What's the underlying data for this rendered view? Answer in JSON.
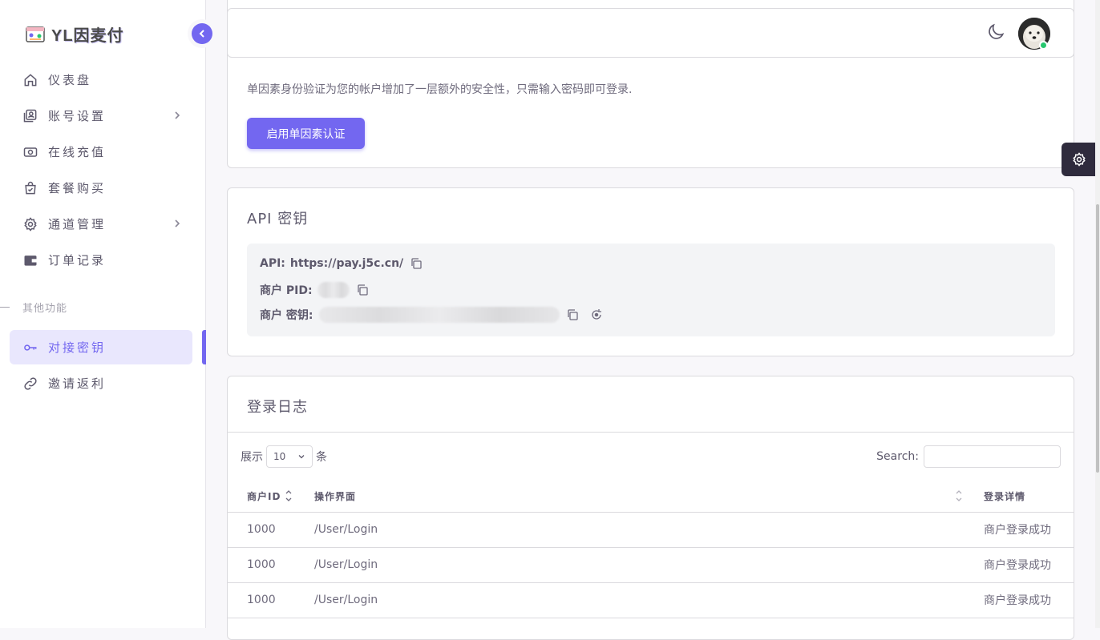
{
  "brand": {
    "name": "YL因麦付"
  },
  "sidebar": {
    "items": [
      {
        "label": "仪表盘",
        "icon": "home-icon"
      },
      {
        "label": "账号设置",
        "icon": "user-card-icon"
      },
      {
        "label": "在线充值",
        "icon": "cash-icon"
      },
      {
        "label": "套餐购买",
        "icon": "bag-icon"
      },
      {
        "label": "通道管理",
        "icon": "gear-icon"
      },
      {
        "label": "订单记录",
        "icon": "wallet-icon"
      },
      {
        "label": "对接密钥",
        "icon": "key-icon"
      },
      {
        "label": "邀请返利",
        "icon": "link-icon"
      }
    ],
    "section_header": "其他功能"
  },
  "security": {
    "description": "单因素身份验证为您的帐户增加了一层额外的安全性，只需输入密码即可登录.",
    "button": "启用单因素认证"
  },
  "api": {
    "title": "API 密钥",
    "api_label": "API:",
    "api_value": "https://pay.j5c.cn/",
    "pid_label": "商户 PID:",
    "key_label": "商户 密钥:"
  },
  "log": {
    "title": "登录日志",
    "show_label": "展示",
    "page_size": "10",
    "entries_label": "条",
    "search_label": "Search:",
    "columns": [
      "商户ID",
      "操作界面",
      "登录详情"
    ],
    "rows": [
      [
        "1000",
        "/User/Login",
        "商户登录成功"
      ],
      [
        "1000",
        "/User/Login",
        "商户登录成功"
      ],
      [
        "1000",
        "/User/Login",
        "商户登录成功"
      ]
    ]
  },
  "colors": {
    "primary": "#7367f0",
    "online": "#28c76f"
  }
}
